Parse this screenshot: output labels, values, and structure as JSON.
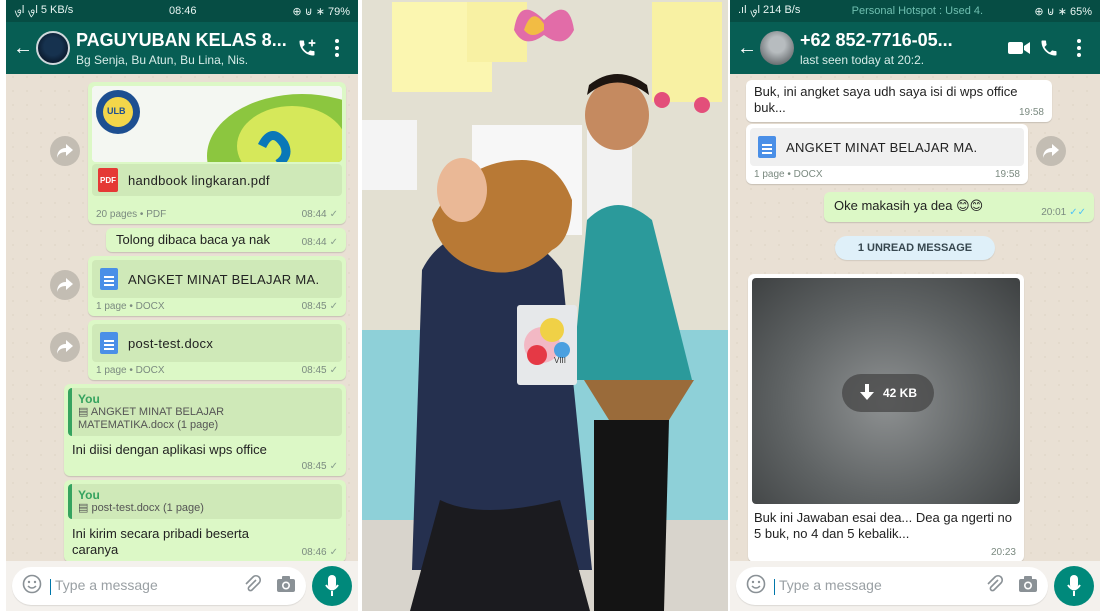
{
  "left": {
    "status": {
      "signal": "ࡐl ࡐl 5 KB/s",
      "time": "08:46",
      "right": "⊕ ⊍ ∗ 79%"
    },
    "header": {
      "title": "PAGUYUBAN KELAS 8...",
      "subtitle": "Bg Senja, Bu Atun, Bu Lina, Nis."
    },
    "messages": [
      {
        "kind": "pdf",
        "name": "handbook lingkaran.pdf",
        "meta": "20 pages • PDF",
        "time": "08:44",
        "tick": "✓",
        "logo_text": "ULB"
      },
      {
        "kind": "text",
        "text": "Tolong dibaca baca ya nak",
        "time": "08:44",
        "tick": "✓"
      },
      {
        "kind": "doc",
        "name": "ANGKET MINAT BELAJAR MA.",
        "meta": "1 page • DOCX",
        "time": "08:45",
        "tick": "✓"
      },
      {
        "kind": "doc",
        "name": "post-test.docx",
        "meta": "1 page • DOCX",
        "time": "08:45",
        "tick": "✓"
      },
      {
        "kind": "reply",
        "who": "You",
        "quote": "▤ ANGKET MINAT BELAJAR MATEMATIKA.docx (1 page)",
        "text": "Ini diisi dengan aplikasi wps office",
        "time": "08:45",
        "tick": "✓"
      },
      {
        "kind": "reply",
        "who": "You",
        "quote": "▤ post-test.docx (1 page)",
        "text": "Ini kirim secara pribadi beserta caranya",
        "time": "08:46",
        "tick": "✓"
      }
    ],
    "input_placeholder": "Type a message"
  },
  "middle": {
    "book_label": "VIII"
  },
  "right": {
    "status": {
      "signal": ".ıl ࡐl 214 B/s",
      "hotspot": "Personal Hotspot : Used 4.",
      "right": "⊕ ⊍ ∗ 65%"
    },
    "header": {
      "title": "+62 852-7716-05...",
      "subtitle": "last seen today at 20:2."
    },
    "messages": [
      {
        "kind": "text",
        "text": "Buk, ini angket saya udh saya isi di wps office buk...",
        "time": "19:58"
      },
      {
        "kind": "doc",
        "name": "ANGKET MINAT BELAJAR MA.",
        "meta": "1 page • DOCX",
        "time": "19:58"
      },
      {
        "kind": "text",
        "text": "Oke makasih ya dea 😊😊",
        "time": "20:01",
        "tick": "✓✓"
      },
      {
        "kind": "image",
        "size": "42 KB",
        "text": "Buk ini Jawaban esai dea...  Dea ga ngerti no 5 buk, no 4 dan 5 kebalik...",
        "time": "20:23"
      }
    ],
    "unread": "1 UNREAD MESSAGE",
    "input_placeholder": "Type a message"
  }
}
